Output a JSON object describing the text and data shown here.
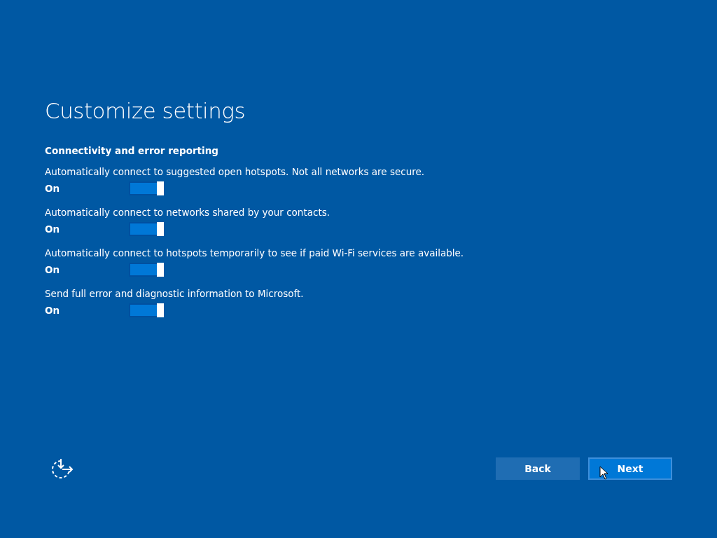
{
  "title": "Customize settings",
  "section": "Connectivity and error reporting",
  "settings": [
    {
      "label": "Automatically connect to suggested open hotspots. Not all networks are secure.",
      "state": "On",
      "on": true
    },
    {
      "label": "Automatically connect to networks shared by your contacts.",
      "state": "On",
      "on": true
    },
    {
      "label": "Automatically connect to hotspots temporarily to see if paid Wi-Fi services are available.",
      "state": "On",
      "on": true
    },
    {
      "label": "Send full error and diagnostic information to Microsoft.",
      "state": "On",
      "on": true
    }
  ],
  "buttons": [
    {
      "label": "Back",
      "focused": false
    },
    {
      "label": "Next",
      "focused": true
    }
  ]
}
